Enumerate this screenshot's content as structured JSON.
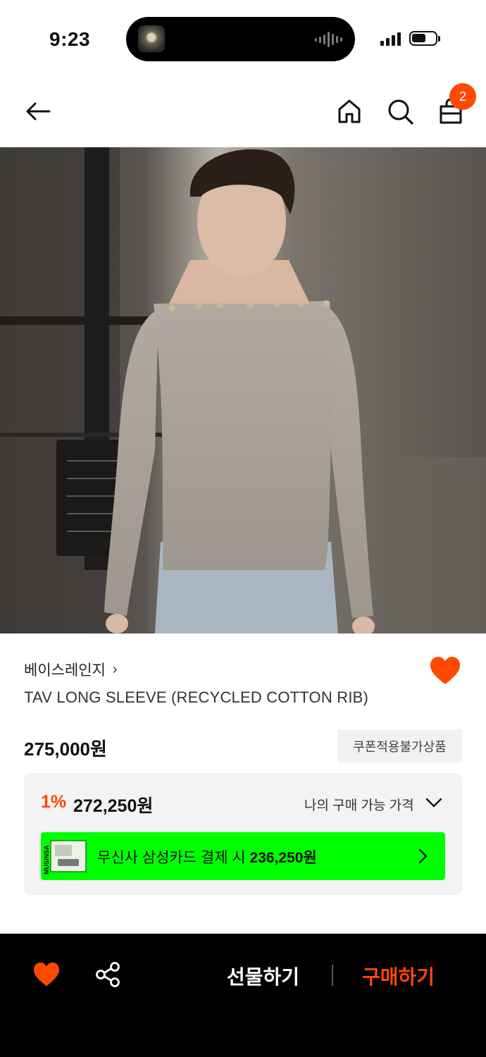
{
  "status_bar": {
    "time": "9:23"
  },
  "header": {
    "cart_count": "2"
  },
  "product": {
    "brand": "베이스레인지",
    "brand_chevron": "›",
    "title": "TAV LONG SLEEVE (RECYCLED COTTON RIB)",
    "price": "275,000원",
    "coupon_label": "쿠폰적용불가상품",
    "discount_rate": "1%",
    "discount_price": "272,250원",
    "my_price_label": "나의 구매 가능 가격",
    "card_offer_prefix": "무신사 삼성카드 결제 시",
    "card_offer_price": "236,250원",
    "card_brand_text": "MUSINSA"
  },
  "bottom_bar": {
    "gift_label": "선물하기",
    "buy_label": "구매하기"
  },
  "colors": {
    "accent": "#ff4800",
    "banner": "#00ff00",
    "bottom_bar": "#000000"
  }
}
